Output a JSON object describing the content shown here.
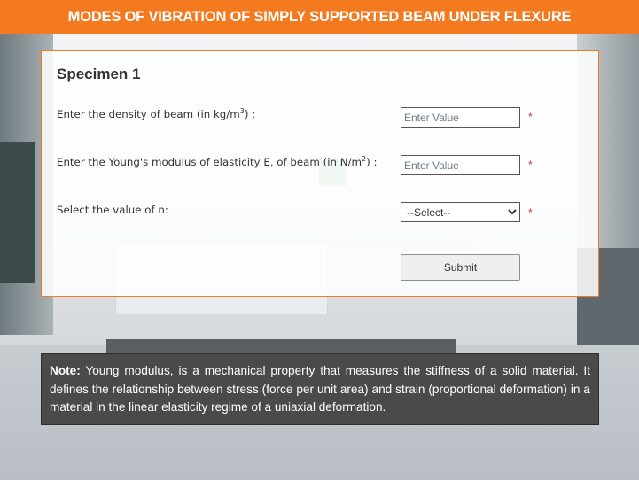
{
  "header": {
    "title": "MODES OF VIBRATION OF SIMPLY SUPPORTED BEAM UNDER FLEXURE"
  },
  "colors": {
    "accent": "#f47a20",
    "required": "#e0302a",
    "note_bg": "#4a4a4a"
  },
  "panel": {
    "title": "Specimen 1",
    "density": {
      "label_prefix": "Enter the density of beam (in kg/m",
      "label_sup": "3",
      "label_suffix": ") :",
      "placeholder": "Enter Value",
      "value": ""
    },
    "youngs": {
      "label_prefix": "Enter the Young's modulus of elasticity E, of beam (in N/m",
      "label_sup": "2",
      "label_suffix": ") :",
      "placeholder": "Enter Value",
      "value": ""
    },
    "n_select": {
      "label": "Select the value of n:",
      "selected": "--Select--"
    },
    "required_mark": "*",
    "submit_label": "Submit"
  },
  "note": {
    "bold_label": "Note:",
    "text": " Young modulus, is a mechanical property that measures the stiffness of a solid material. It defines the relationship between stress (force per unit area) and strain (proportional deformation) in a material in the linear elasticity regime of a uniaxial deformation."
  }
}
